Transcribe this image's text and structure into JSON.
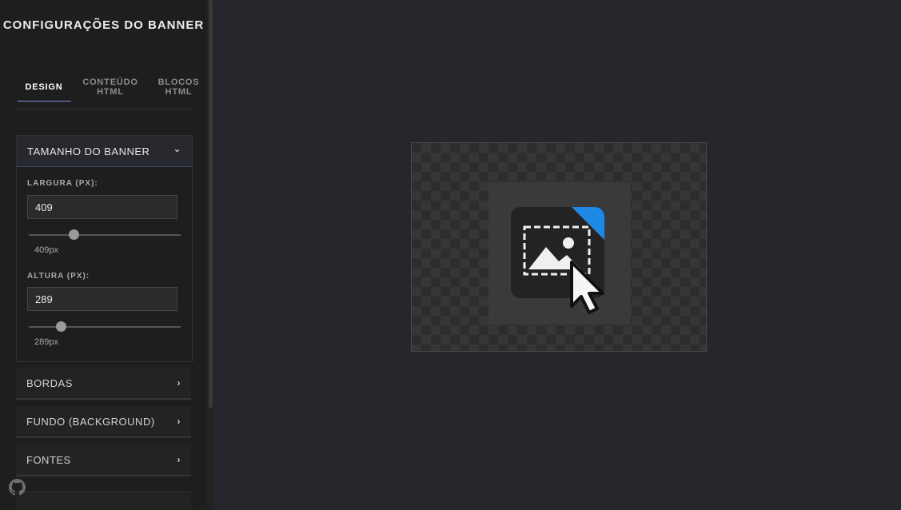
{
  "sidebar": {
    "title": "CONFIGURAÇÕES DO BANNER",
    "tabs": [
      {
        "line1": "DESIGN",
        "line2": ""
      },
      {
        "line1": "CONTEÚDO",
        "line2": "HTML"
      },
      {
        "line1": "BLOCOS",
        "line2": "HTML"
      }
    ],
    "active_tab": "DESIGN",
    "sections": {
      "size": {
        "title": "TAMANHO DO BANNER",
        "expanded": true,
        "width_label": "LARGURA (PX):",
        "width_value": "409",
        "width_readout": "409px",
        "width_slider_fraction": 0.28,
        "height_label": "ALTURA (PX):",
        "height_value": "289",
        "height_readout": "289px",
        "height_slider_fraction": 0.19
      },
      "borders": {
        "title": "BORDAS"
      },
      "background": {
        "title": "FUNDO (BACKGROUND)"
      },
      "fonts": {
        "title": "FONTES"
      }
    }
  },
  "icons": {
    "expanded_chevron": "⌄",
    "collapsed_chevron": "›",
    "github": "github-icon",
    "placeholder": "image-select-cursor-icon"
  },
  "colors": {
    "accent": "#7b8fd8",
    "corner_badge": "#1e88e5",
    "background": "#27262c",
    "sidebar": "#1e1e1e"
  }
}
